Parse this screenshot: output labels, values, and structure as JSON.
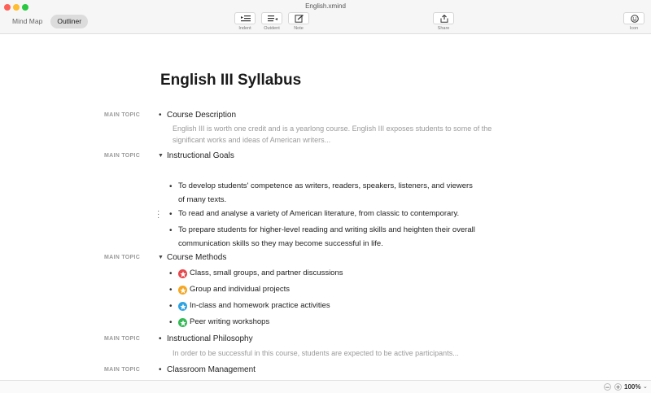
{
  "window": {
    "title": "English.xmind"
  },
  "view_switch": {
    "tabs": [
      "Mind Map",
      "Outliner"
    ],
    "active": "Outliner"
  },
  "toolbar": {
    "indent_label": "Indent",
    "outdent_label": "Outdent",
    "note_label": "Note",
    "share_label": "Share",
    "icon_label": "Icon"
  },
  "document": {
    "title": "English III Syllabus",
    "topic_label": "MAIN TOPIC",
    "topics": [
      {
        "text": "Course Description",
        "note_lines": [
          "English III is worth one credit and is a yearlong course. English III exposes students to some of the",
          "significant works and ideas of American writers..."
        ]
      },
      {
        "text": "Instructional Goals",
        "subtopics": [
          [
            "To develop students' competence as writers, readers, speakers, listeners, and viewers",
            "of many texts."
          ],
          [
            "To read and analyse a variety of American literature, from classic to contemporary."
          ],
          [
            "To prepare students for higher-level reading and writing skills and heighten their overall",
            "communication skills so they may become successful in life."
          ]
        ]
      },
      {
        "text": "Course Methods",
        "subtopics": [
          {
            "text": "Class, small groups, and partner discussions",
            "marker": "star-red-icon",
            "color": "#e5484d"
          },
          {
            "text": "Group and individual projects",
            "marker": "star-orange-icon",
            "color": "#f5a623"
          },
          {
            "text": "In-class and homework practice activities",
            "marker": "star-blue-icon",
            "color": "#2ea3e3"
          },
          {
            "text": "Peer writing workshops",
            "marker": "star-green-icon",
            "color": "#34b955"
          }
        ]
      },
      {
        "text": "Instructional Philosophy",
        "note_lines": [
          "In order to be successful in this course, students are expected to be active participants..."
        ]
      },
      {
        "text": "Classroom Management"
      }
    ]
  },
  "statusbar": {
    "zoom_out": "−",
    "zoom_in": "+",
    "zoom_level": "100%"
  },
  "colors": {
    "window_bg": "#ffffff",
    "toolbar_bg": "#f6f6f6",
    "topic_label": "#9a9a9a",
    "note_text": "#9a9a9a"
  }
}
